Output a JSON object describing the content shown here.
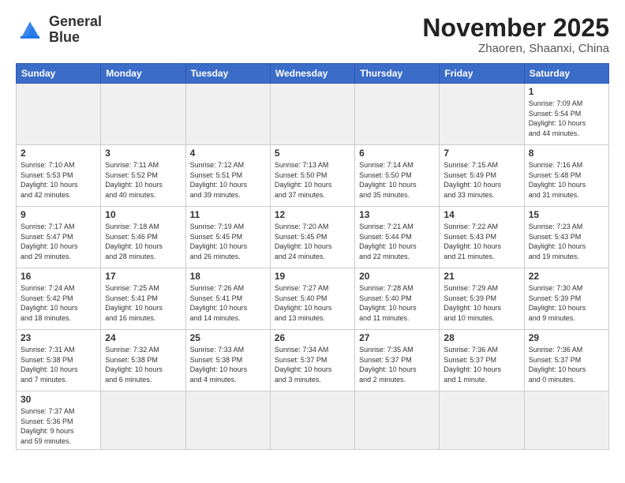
{
  "logo": {
    "line1": "General",
    "line2": "Blue"
  },
  "title": "November 2025",
  "location": "Zhaoren, Shaanxi, China",
  "weekdays": [
    "Sunday",
    "Monday",
    "Tuesday",
    "Wednesday",
    "Thursday",
    "Friday",
    "Saturday"
  ],
  "weeks": [
    [
      {
        "day": "",
        "info": ""
      },
      {
        "day": "",
        "info": ""
      },
      {
        "day": "",
        "info": ""
      },
      {
        "day": "",
        "info": ""
      },
      {
        "day": "",
        "info": ""
      },
      {
        "day": "",
        "info": ""
      },
      {
        "day": "1",
        "info": "Sunrise: 7:09 AM\nSunset: 5:54 PM\nDaylight: 10 hours\nand 44 minutes."
      }
    ],
    [
      {
        "day": "2",
        "info": "Sunrise: 7:10 AM\nSunset: 5:53 PM\nDaylight: 10 hours\nand 42 minutes."
      },
      {
        "day": "3",
        "info": "Sunrise: 7:11 AM\nSunset: 5:52 PM\nDaylight: 10 hours\nand 40 minutes."
      },
      {
        "day": "4",
        "info": "Sunrise: 7:12 AM\nSunset: 5:51 PM\nDaylight: 10 hours\nand 39 minutes."
      },
      {
        "day": "5",
        "info": "Sunrise: 7:13 AM\nSunset: 5:50 PM\nDaylight: 10 hours\nand 37 minutes."
      },
      {
        "day": "6",
        "info": "Sunrise: 7:14 AM\nSunset: 5:50 PM\nDaylight: 10 hours\nand 35 minutes."
      },
      {
        "day": "7",
        "info": "Sunrise: 7:15 AM\nSunset: 5:49 PM\nDaylight: 10 hours\nand 33 minutes."
      },
      {
        "day": "8",
        "info": "Sunrise: 7:16 AM\nSunset: 5:48 PM\nDaylight: 10 hours\nand 31 minutes."
      }
    ],
    [
      {
        "day": "9",
        "info": "Sunrise: 7:17 AM\nSunset: 5:47 PM\nDaylight: 10 hours\nand 29 minutes."
      },
      {
        "day": "10",
        "info": "Sunrise: 7:18 AM\nSunset: 5:46 PM\nDaylight: 10 hours\nand 28 minutes."
      },
      {
        "day": "11",
        "info": "Sunrise: 7:19 AM\nSunset: 5:45 PM\nDaylight: 10 hours\nand 26 minutes."
      },
      {
        "day": "12",
        "info": "Sunrise: 7:20 AM\nSunset: 5:45 PM\nDaylight: 10 hours\nand 24 minutes."
      },
      {
        "day": "13",
        "info": "Sunrise: 7:21 AM\nSunset: 5:44 PM\nDaylight: 10 hours\nand 22 minutes."
      },
      {
        "day": "14",
        "info": "Sunrise: 7:22 AM\nSunset: 5:43 PM\nDaylight: 10 hours\nand 21 minutes."
      },
      {
        "day": "15",
        "info": "Sunrise: 7:23 AM\nSunset: 5:43 PM\nDaylight: 10 hours\nand 19 minutes."
      }
    ],
    [
      {
        "day": "16",
        "info": "Sunrise: 7:24 AM\nSunset: 5:42 PM\nDaylight: 10 hours\nand 18 minutes."
      },
      {
        "day": "17",
        "info": "Sunrise: 7:25 AM\nSunset: 5:41 PM\nDaylight: 10 hours\nand 16 minutes."
      },
      {
        "day": "18",
        "info": "Sunrise: 7:26 AM\nSunset: 5:41 PM\nDaylight: 10 hours\nand 14 minutes."
      },
      {
        "day": "19",
        "info": "Sunrise: 7:27 AM\nSunset: 5:40 PM\nDaylight: 10 hours\nand 13 minutes."
      },
      {
        "day": "20",
        "info": "Sunrise: 7:28 AM\nSunset: 5:40 PM\nDaylight: 10 hours\nand 11 minutes."
      },
      {
        "day": "21",
        "info": "Sunrise: 7:29 AM\nSunset: 5:39 PM\nDaylight: 10 hours\nand 10 minutes."
      },
      {
        "day": "22",
        "info": "Sunrise: 7:30 AM\nSunset: 5:39 PM\nDaylight: 10 hours\nand 9 minutes."
      }
    ],
    [
      {
        "day": "23",
        "info": "Sunrise: 7:31 AM\nSunset: 5:38 PM\nDaylight: 10 hours\nand 7 minutes."
      },
      {
        "day": "24",
        "info": "Sunrise: 7:32 AM\nSunset: 5:38 PM\nDaylight: 10 hours\nand 6 minutes."
      },
      {
        "day": "25",
        "info": "Sunrise: 7:33 AM\nSunset: 5:38 PM\nDaylight: 10 hours\nand 4 minutes."
      },
      {
        "day": "26",
        "info": "Sunrise: 7:34 AM\nSunset: 5:37 PM\nDaylight: 10 hours\nand 3 minutes."
      },
      {
        "day": "27",
        "info": "Sunrise: 7:35 AM\nSunset: 5:37 PM\nDaylight: 10 hours\nand 2 minutes."
      },
      {
        "day": "28",
        "info": "Sunrise: 7:36 AM\nSunset: 5:37 PM\nDaylight: 10 hours\nand 1 minute."
      },
      {
        "day": "29",
        "info": "Sunrise: 7:36 AM\nSunset: 5:37 PM\nDaylight: 10 hours\nand 0 minutes."
      }
    ],
    [
      {
        "day": "30",
        "info": "Sunrise: 7:37 AM\nSunset: 5:36 PM\nDaylight: 9 hours\nand 59 minutes."
      },
      {
        "day": "",
        "info": ""
      },
      {
        "day": "",
        "info": ""
      },
      {
        "day": "",
        "info": ""
      },
      {
        "day": "",
        "info": ""
      },
      {
        "day": "",
        "info": ""
      },
      {
        "day": "",
        "info": ""
      }
    ]
  ]
}
